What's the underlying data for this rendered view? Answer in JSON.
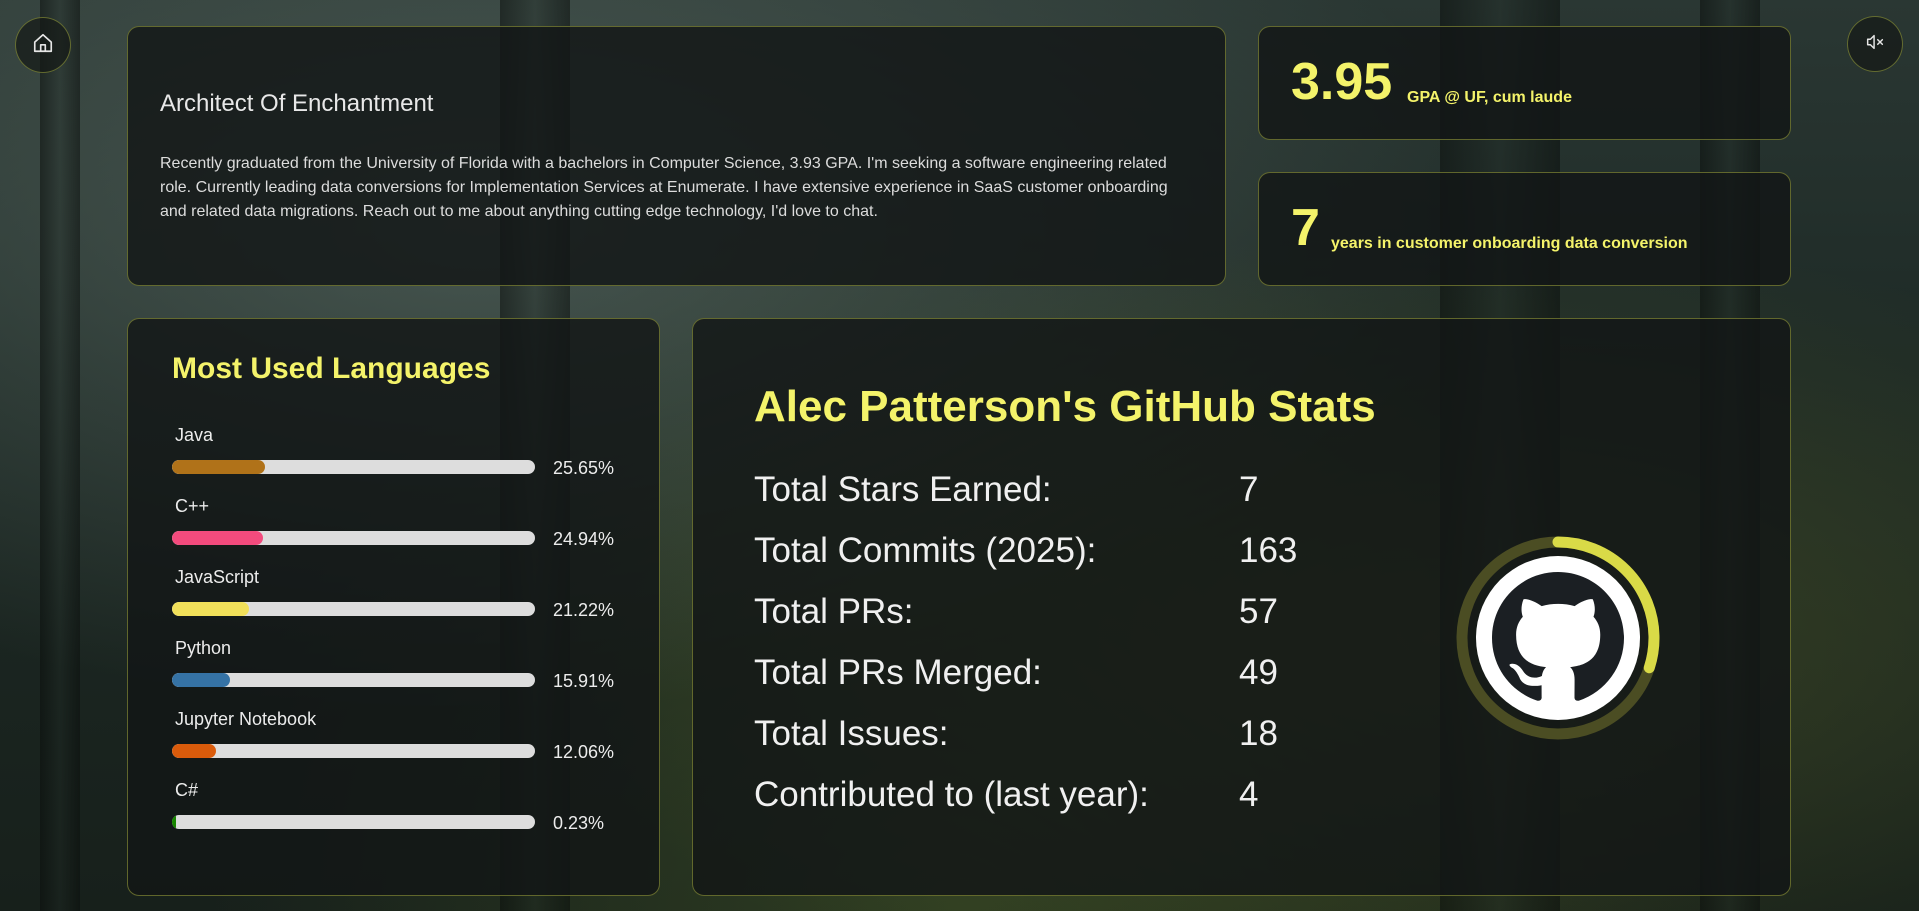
{
  "about": {
    "title": "Architect Of Enchantment",
    "body": "Recently graduated from the University of Florida with a bachelors in Computer Science, 3.93 GPA. I'm seeking a software engineering related role. Currently leading data conversions for Implementation Services at Enumerate. I have extensive experience in SaaS customer onboarding and related data migrations. Reach out to me about anything cutting edge technology, I'd love to chat."
  },
  "stats": [
    {
      "value": "3.95",
      "label": "GPA @ UF, cum laude"
    },
    {
      "value": "7",
      "label": "years in customer onboarding data conversion"
    }
  ],
  "languages": {
    "title": "Most Used Languages",
    "items": [
      {
        "name": "Java",
        "percent": "25.65%",
        "value": 25.65,
        "color": "#b07219"
      },
      {
        "name": "C++",
        "percent": "24.94%",
        "value": 24.94,
        "color": "#f34b7d"
      },
      {
        "name": "JavaScript",
        "percent": "21.22%",
        "value": 21.22,
        "color": "#f1e05a"
      },
      {
        "name": "Python",
        "percent": "15.91%",
        "value": 15.91,
        "color": "#3572a5"
      },
      {
        "name": "Jupyter Notebook",
        "percent": "12.06%",
        "value": 12.06,
        "color": "#da5b0b"
      },
      {
        "name": "C#",
        "percent": "0.23%",
        "value": 0.23,
        "color": "#178600"
      }
    ]
  },
  "github": {
    "title": "Alec Patterson's GitHub Stats",
    "rows": [
      {
        "label": "Total Stars Earned:",
        "value": "7"
      },
      {
        "label": "Total Commits (2025):",
        "value": "163"
      },
      {
        "label": "Total PRs:",
        "value": "57"
      },
      {
        "label": "Total PRs Merged:",
        "value": "49"
      },
      {
        "label": "Total Issues:",
        "value": "18"
      },
      {
        "label": "Contributed to (last year):",
        "value": "4"
      }
    ],
    "ring_progress": 0.3
  },
  "icons": {
    "home": "home-icon",
    "mute": "volume-mute-icon",
    "github": "github-icon"
  },
  "colors": {
    "accent": "#f4f36a",
    "border": "#bec846"
  }
}
